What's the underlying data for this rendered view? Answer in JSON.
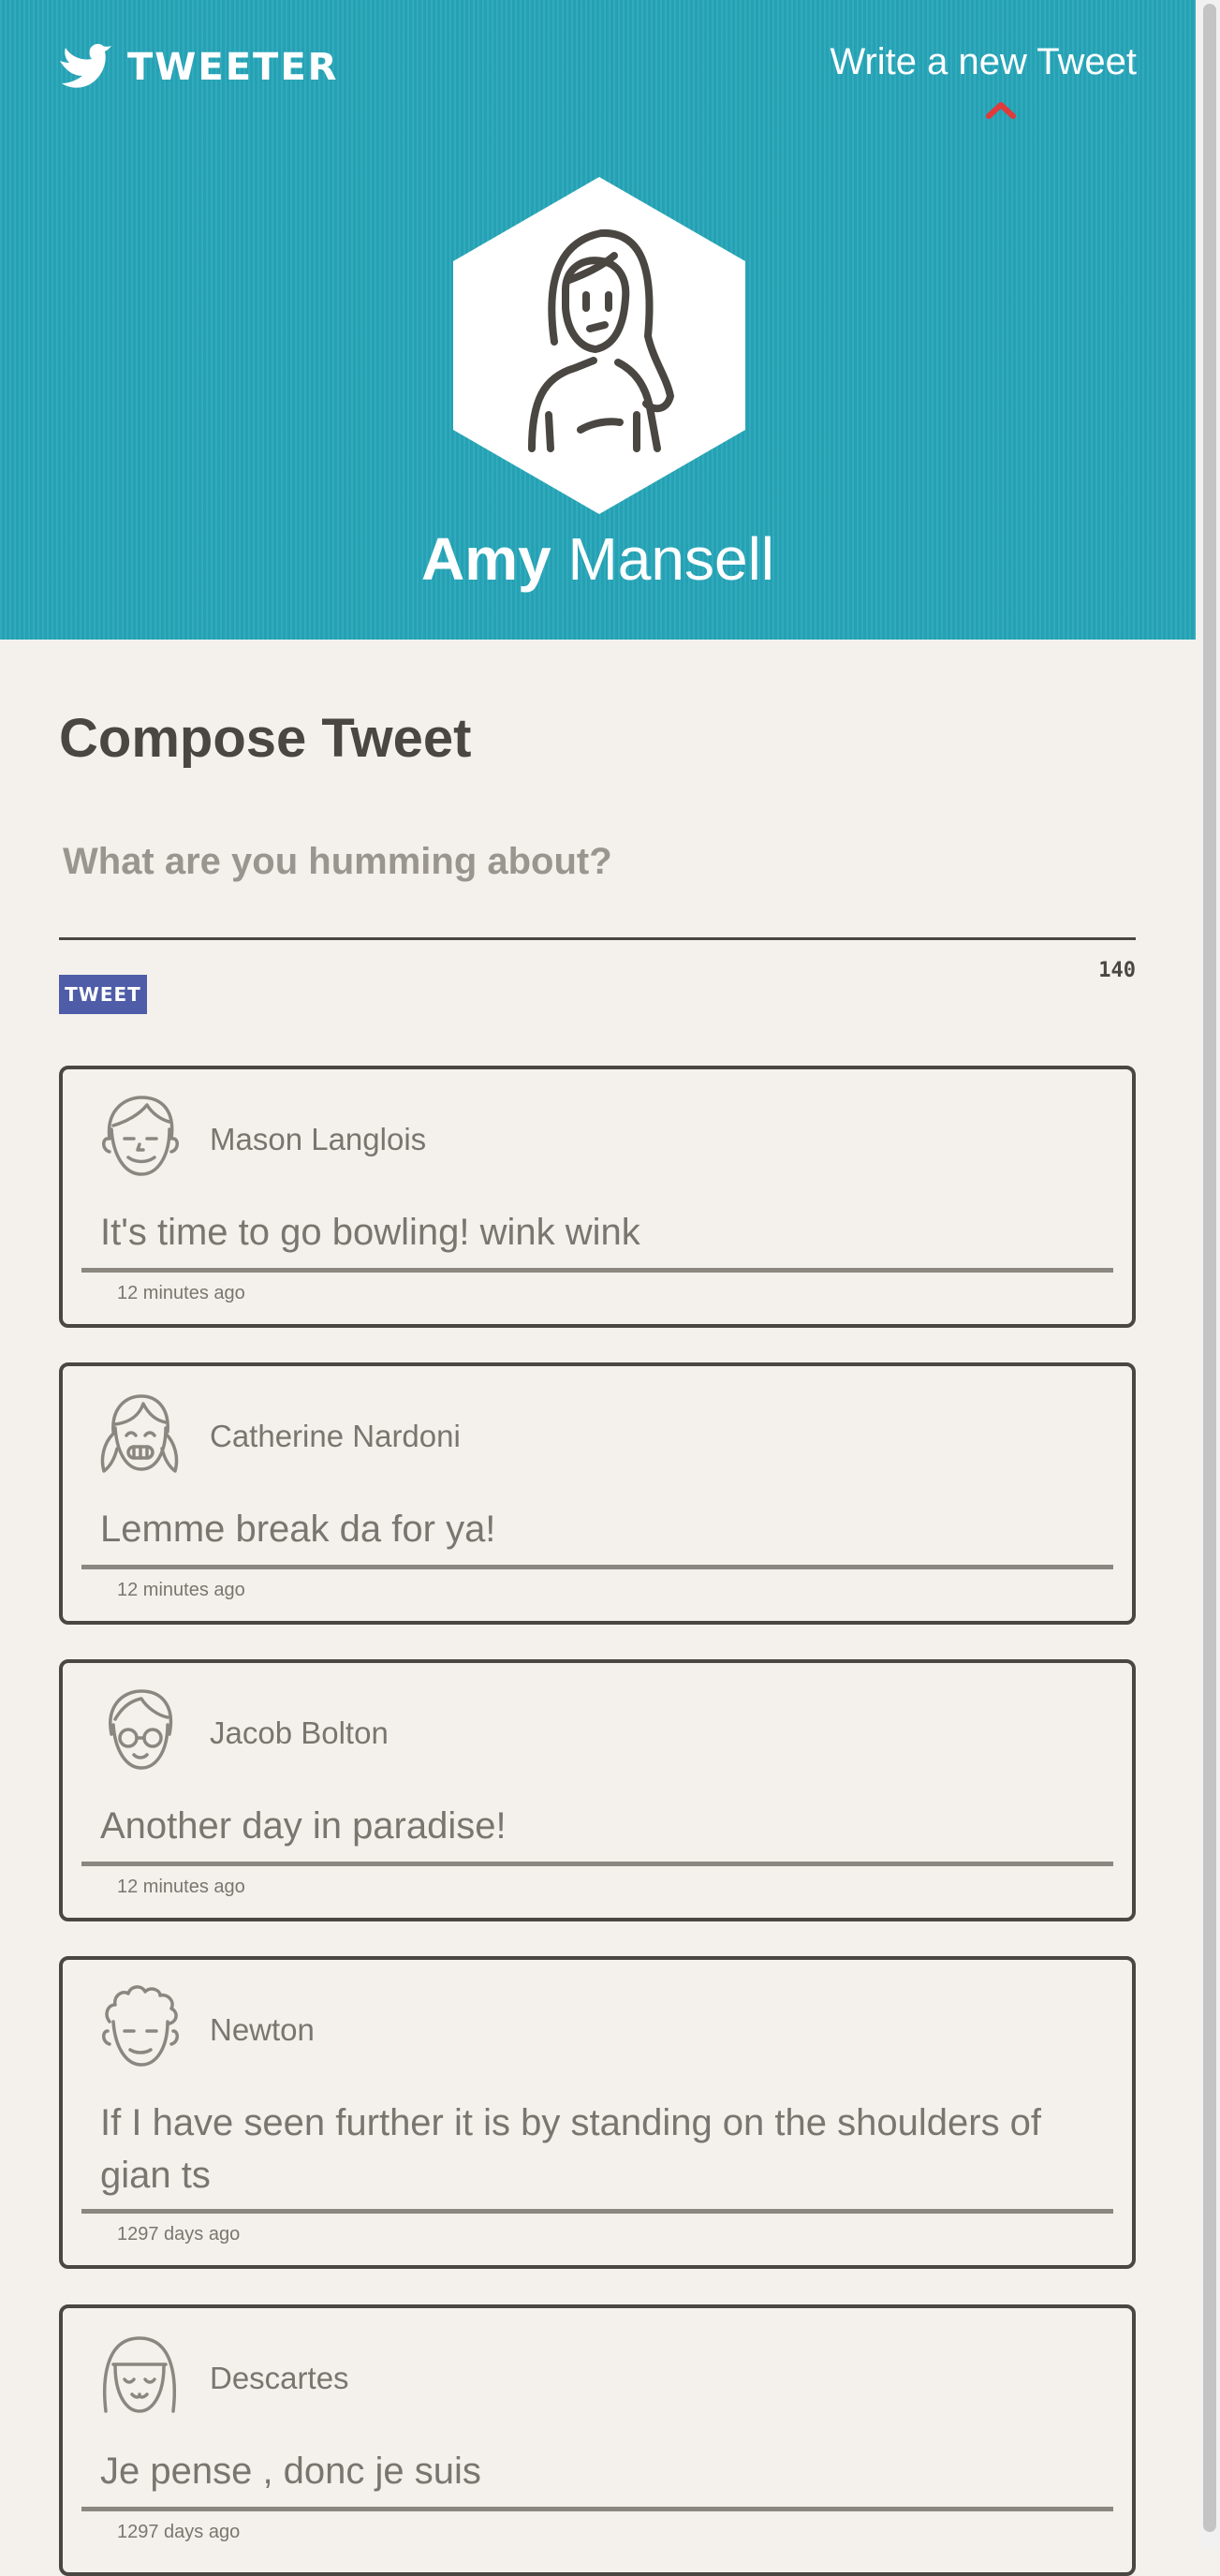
{
  "header": {
    "brand": "TWEETER",
    "brand_icon": "bird-icon",
    "compose_toggle_label": "Write a new Tweet",
    "compose_toggle_icon": "chevron-up-icon",
    "accent_color": "#26a6b9",
    "toggle_arrow_color": "#e03a3a"
  },
  "profile": {
    "first_name": "Amy",
    "last_name": "Mansell",
    "avatar_icon": "woman-avatar-icon"
  },
  "compose": {
    "title": "Compose Tweet",
    "placeholder": "What are you humming about?",
    "value": "",
    "button_label": "TWEET",
    "button_color": "#4f5da8",
    "counter": "140"
  },
  "tweets": [
    {
      "author": "Mason Langlois",
      "avatar_icon": "smiling-boy-avatar-icon",
      "text": "It's time to go bowling! wink wink",
      "time": "12 minutes ago"
    },
    {
      "author": "Catherine Nardoni",
      "avatar_icon": "girl-pigtails-avatar-icon",
      "text": "Lemme break da for ya!",
      "time": "12 minutes ago"
    },
    {
      "author": "Jacob Bolton",
      "avatar_icon": "glasses-avatar-icon",
      "text": "Another day in paradise!",
      "time": "12 minutes ago"
    },
    {
      "author": "Newton",
      "avatar_icon": "curly-hair-avatar-icon",
      "text": "If I have seen further it is by standing on the shoulders of gian ts",
      "time": "1297 days ago"
    },
    {
      "author": "Descartes",
      "avatar_icon": "bob-hair-avatar-icon",
      "text": "Je pense , donc je suis",
      "time": "1297 days ago"
    }
  ]
}
